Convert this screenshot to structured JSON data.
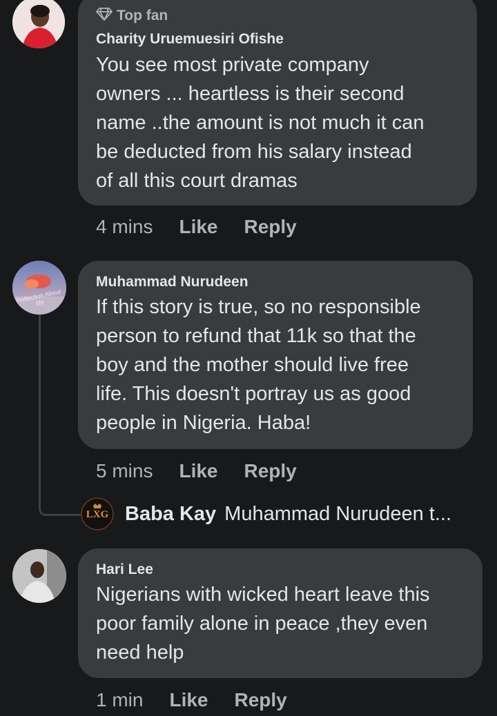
{
  "comments": [
    {
      "badge": "Top fan",
      "name": "Charity Uruemuesiri Ofishe",
      "text": "You see most private company\nowners ... heartless is their second\nname ..the amount is not much it can\nbe deducted from his salary instead\nof all this court dramas",
      "time": "4 mins",
      "like": "Like",
      "reply": "Reply"
    },
    {
      "name": "Muhammad Nurudeen",
      "avatar_caption": "Reflection About life",
      "text": "If this story is true, so no responsible\nperson to refund that 11k so that the\nboy and the mother should live free\nlife. This doesn't portray us as good\npeople in Nigeria. Haba!",
      "time": "5 mins",
      "like": "Like",
      "reply": "Reply"
    },
    {
      "name": "Hari Lee",
      "text": "Nigerians with wicked heart leave this\npoor family alone in peace ,they even\nneed help",
      "time": "1 min",
      "like": "Like",
      "reply": "Reply"
    }
  ],
  "reply_preview": {
    "name": "Baba Kay",
    "text": "Muhammad Nurudeen t...",
    "avatar_logo": "LXG"
  },
  "icons": {
    "badge": "diamond-icon"
  },
  "colors": {
    "background": "#18191a",
    "bubble": "#3a3b3c",
    "primary_text": "#e4e6eb",
    "secondary_text": "#b0b3b8"
  }
}
